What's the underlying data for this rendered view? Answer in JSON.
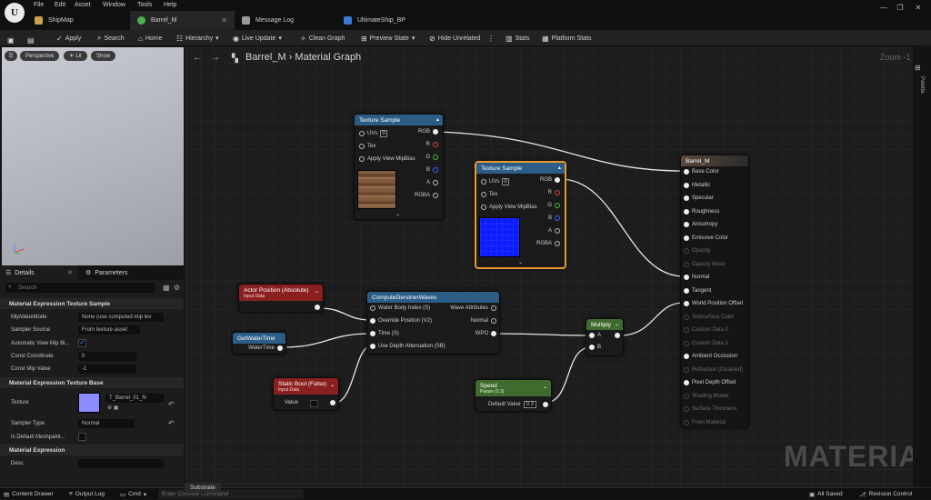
{
  "menu": [
    "File",
    "Edit",
    "Asset",
    "Window",
    "Tools",
    "Help"
  ],
  "tabs": [
    {
      "label": "ShipMap",
      "icon": "map-icon"
    },
    {
      "label": "Barrel_M",
      "icon": "material-icon",
      "active": true
    },
    {
      "label": "Message Log",
      "icon": "log-icon"
    },
    {
      "label": "UltimateShip_BP",
      "icon": "blueprint-icon"
    }
  ],
  "toolbar": {
    "apply": "Apply",
    "search": "Search",
    "home": "Home",
    "hierarchy": "Hierarchy",
    "live_update": "Live Update",
    "clean_graph": "Clean Graph",
    "preview_state": "Preview State",
    "hide_unrelated": "Hide Unrelated",
    "stats": "Stats",
    "platform_stats": "Platform Stats"
  },
  "viewport": {
    "perspective": "Perspective",
    "lit": "Lit",
    "show": "Show"
  },
  "details": {
    "tab_details": "Details",
    "tab_parameters": "Parameters",
    "search_placeholder": "Search",
    "section1": "Material Expression Texture Sample",
    "mip_value_mode_label": "MipValueMode",
    "mip_value_mode_value": "None (use computed mip lev",
    "sampler_source_label": "Sampler Source",
    "sampler_source_value": "From texture asset",
    "auto_view_mip_label": "Automatic View Mip Bi...",
    "const_coord_label": "Const Coordinate",
    "const_coord_value": "0",
    "const_mip_label": "Const Mip Value",
    "const_mip_value": "-1",
    "section2": "Material Expression Texture Base",
    "texture_label": "Texture",
    "texture_value": "T_Barrel_01_N",
    "sampler_type_label": "Sampler Type",
    "sampler_type_value": "Normal",
    "is_default_label": "Is Default Meshpaint...",
    "section3": "Material Expression",
    "desc_label": "Desc"
  },
  "graph": {
    "breadcrumb_asset": "Barrel_M",
    "breadcrumb_sep": "›",
    "breadcrumb_graph": "Material Graph",
    "zoom": "Zoom -1",
    "palette": "Palette",
    "watermark": "MATERIAL"
  },
  "nodes": {
    "tex1": {
      "title": "Texture Sample",
      "uvs": "UVs",
      "uv_idx": "0",
      "tex": "Tex",
      "apply": "Apply View MipBias",
      "rgb": "RGB",
      "r": "R",
      "g": "G",
      "b": "B",
      "a": "A",
      "rgba": "RGBA"
    },
    "tex2": {
      "title": "Texture Sample",
      "uvs": "UVs",
      "uv_idx": "0",
      "tex": "Tex",
      "apply": "Apply View MipBias",
      "rgb": "RGB",
      "r": "R",
      "g": "G",
      "b": "B",
      "a": "A",
      "rgba": "RGBA"
    },
    "barrel": {
      "title": "Barrel_M",
      "pins": [
        {
          "label": "Base Color",
          "active": true
        },
        {
          "label": "Metallic",
          "active": true
        },
        {
          "label": "Specular",
          "active": true
        },
        {
          "label": "Roughness",
          "active": true
        },
        {
          "label": "Anisotropy",
          "active": true
        },
        {
          "label": "Emissive Color",
          "active": true
        },
        {
          "label": "Opacity",
          "active": false
        },
        {
          "label": "Opacity Mask",
          "active": false
        },
        {
          "label": "Normal",
          "active": true
        },
        {
          "label": "Tangent",
          "active": true
        },
        {
          "label": "World Position Offset",
          "active": true
        },
        {
          "label": "Subsurface Color",
          "active": false
        },
        {
          "label": "Custom Data 0",
          "active": false
        },
        {
          "label": "Custom Data 1",
          "active": false
        },
        {
          "label": "Ambient Occlusion",
          "active": true
        },
        {
          "label": "Refraction (Disabled)",
          "active": false
        },
        {
          "label": "Pixel Depth Offset",
          "active": true
        },
        {
          "label": "Shading Model",
          "active": false
        },
        {
          "label": "Surface Thickness",
          "active": false
        },
        {
          "label": "Front Material",
          "active": false
        }
      ]
    },
    "actor": {
      "title": "Actor Position (Absolute)",
      "subtitle": "Input Data"
    },
    "wavefn": {
      "title": "ComputeGerstnerWaves",
      "in1": "Water Body Index (S)",
      "in2": "Override Position (V2)",
      "in3": "Time (S)",
      "in4": "Use Depth Attenuation (SB)",
      "out1": "Wave Attributes",
      "out2": "Normal",
      "out3": "WPO"
    },
    "time": {
      "title": "GetWaterTime",
      "out": "WaterTime"
    },
    "multiply": {
      "title": "Multiply",
      "a": "A",
      "b": "B"
    },
    "static_bool": {
      "title": "Static Bool (False)",
      "subtitle": "Input Data",
      "value": "Value"
    },
    "speed": {
      "title": "Speed",
      "subtitle": "Param (0.3)",
      "default_label": "Default Value",
      "default_value": "0.3"
    }
  },
  "status": {
    "content_drawer": "Content Drawer",
    "output_log": "Output Log",
    "cmd": "Cmd",
    "console_placeholder": "Enter Console Command",
    "substrate": "Substrate",
    "all_saved": "All Saved",
    "revision": "Revision Control"
  },
  "colors": {
    "tex_header": "#2b5d86",
    "red_header": "#8a1f1f",
    "green_header": "#3f6b2e",
    "tex2_outline": "#e89a2e",
    "blue_preview": "#0a1cff",
    "texture_swatch": "#8c8cff"
  }
}
